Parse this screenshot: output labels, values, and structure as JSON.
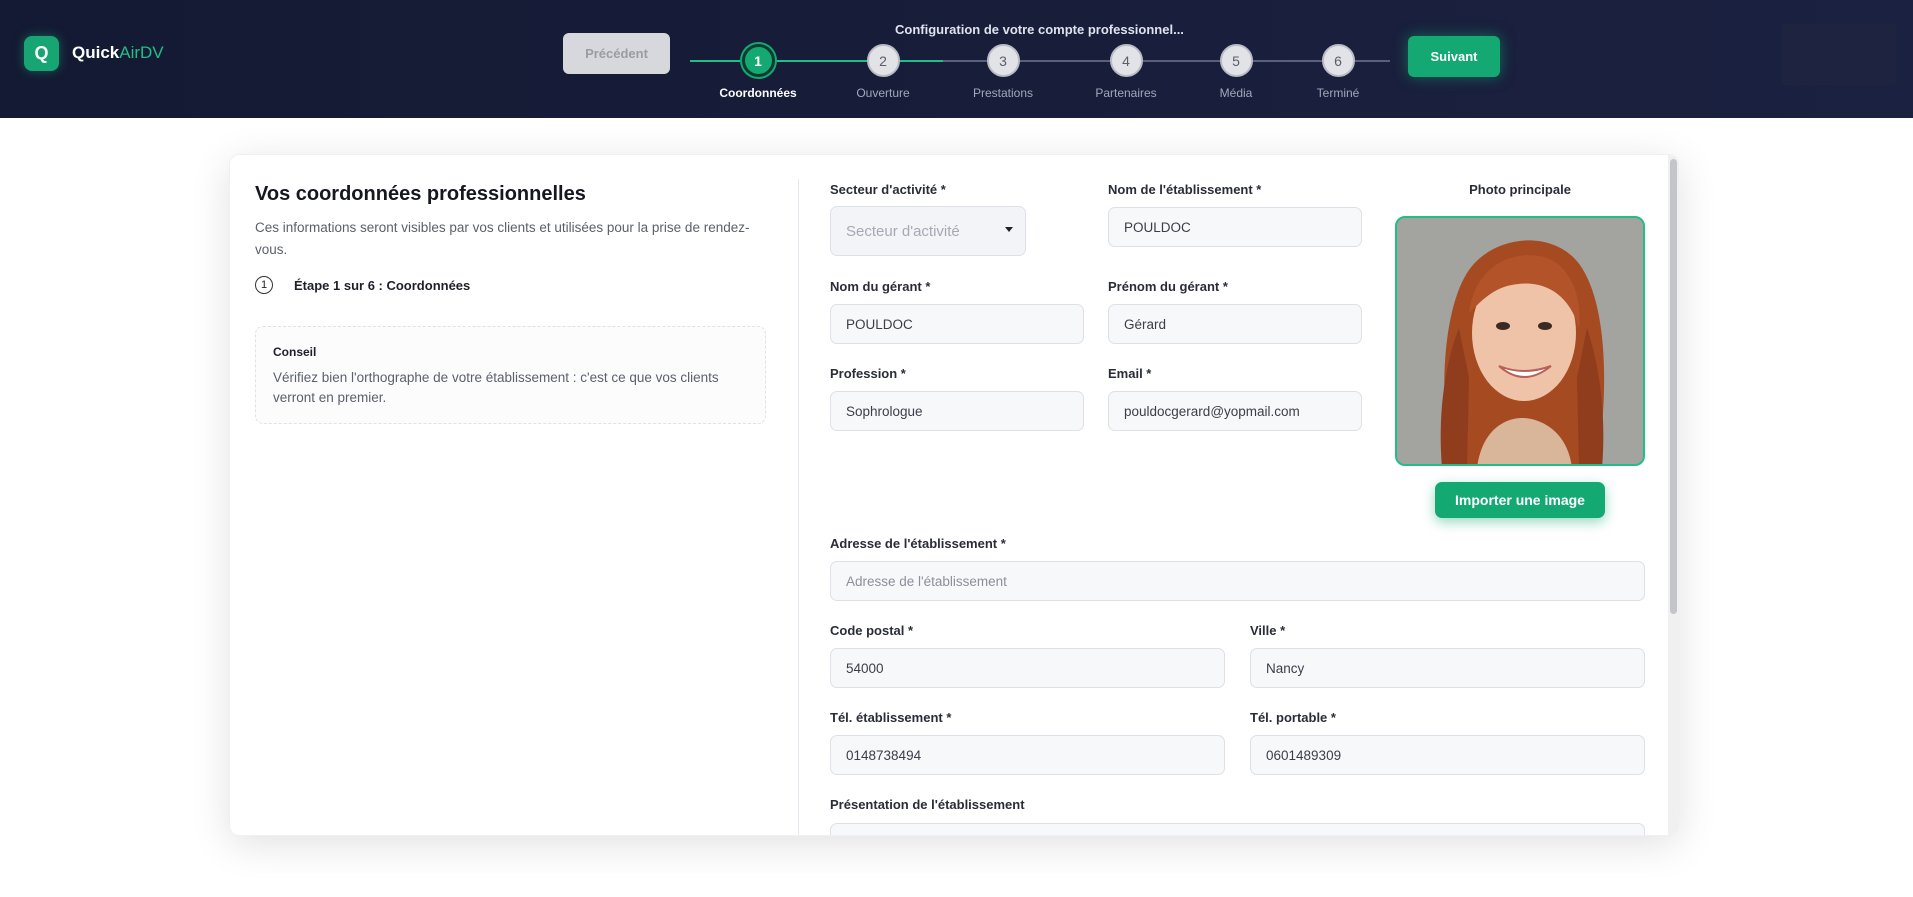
{
  "header": {
    "logo_letter": "Q",
    "brand_main": "Quick",
    "brand_accent": "AirDV",
    "config_title": "Configuration de votre compte professionnel...",
    "prev_label": "Précédent",
    "next_label": "Suivant",
    "steps": [
      {
        "num": "1",
        "label": "Coordonnées",
        "active": true
      },
      {
        "num": "2",
        "label": "Ouverture",
        "active": false
      },
      {
        "num": "3",
        "label": "Prestations",
        "active": false
      },
      {
        "num": "4",
        "label": "Partenaires",
        "active": false
      },
      {
        "num": "5",
        "label": "Média",
        "active": false
      },
      {
        "num": "6",
        "label": "Terminé",
        "active": false
      }
    ]
  },
  "left": {
    "title": "Vos coordonnées professionnelles",
    "description": "Ces informations seront visibles par vos clients et utilisées pour la prise de rendez-vous.",
    "step_num": "1",
    "step_text": "Étape 1 sur 6 : Coordonnées",
    "tip_title": "Conseil",
    "tip_text": "Vérifiez bien l'orthographe de votre établissement : c'est ce que vos clients verront en premier."
  },
  "form": {
    "secteur_label": "Secteur d'activité *",
    "secteur_placeholder": "Secteur d'activité",
    "etab_label": "Nom de l'établissement *",
    "etab_value": "POULDOC",
    "gerant_nom_label": "Nom du gérant *",
    "gerant_nom_value": "POULDOC",
    "gerant_prenom_label": "Prénom du gérant *",
    "gerant_prenom_value": "Gérard",
    "profession_label": "Profession *",
    "profession_value": "Sophrologue",
    "email_label": "Email *",
    "email_value": "pouldocgerard@yopmail.com",
    "photo_label": "Photo principale",
    "import_label": "Importer une image",
    "adresse_label": "Adresse de l'établissement *",
    "adresse_placeholder": "Adresse de l'établissement",
    "cp_label": "Code postal *",
    "cp_value": "54000",
    "ville_label": "Ville *",
    "ville_value": "Nancy",
    "tel_etab_label": "Tél. établissement *",
    "tel_etab_value": "0148738494",
    "tel_port_label": "Tél. portable *",
    "tel_port_value": "0601489309",
    "presentation_label": "Présentation de l'établissement"
  },
  "colors": {
    "accent": "#14a872",
    "header_bg": "#141a33"
  }
}
